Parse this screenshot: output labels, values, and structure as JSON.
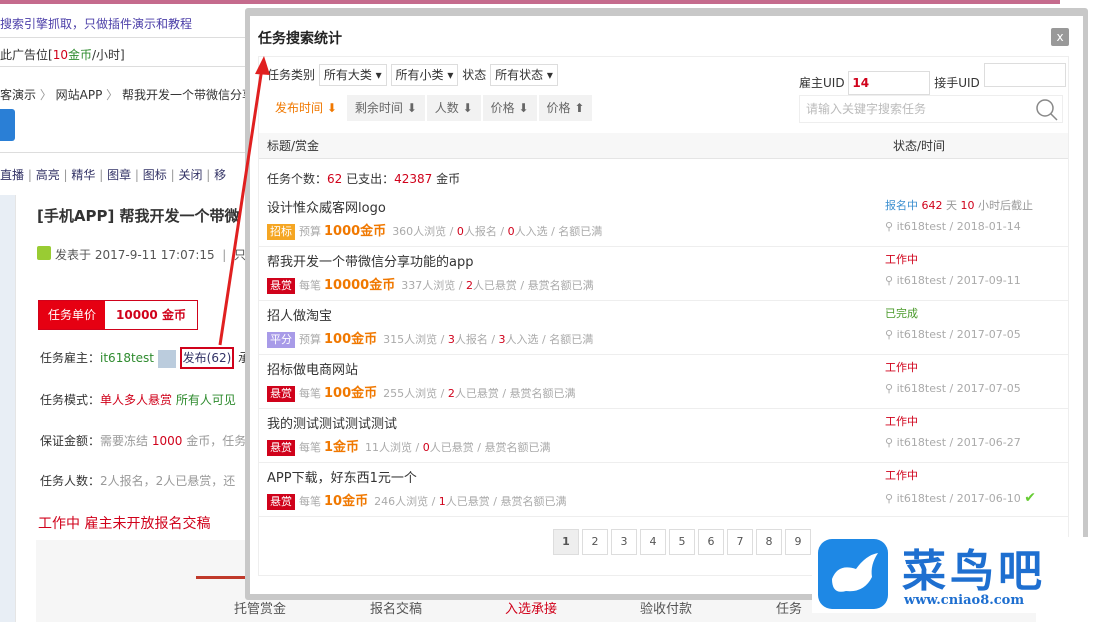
{
  "background": {
    "notice": "搜索引擎抓取，只做插件演示和教程",
    "ad": {
      "prefix": "此广告位[",
      "num": "10",
      "unit": "金币",
      "suffix": "/小时]"
    },
    "breadcrumb": [
      "客演示",
      "网站APP",
      "帮我开发一个带微信分享"
    ],
    "actions": [
      "直播",
      "高亮",
      "精华",
      "图章",
      "图标",
      "关闭",
      "移"
    ],
    "post_title": "[手机APP] 帮我开发一个带微",
    "post_meta": {
      "label": "发表于",
      "date": "2017-9-11 17:07:15",
      "extra": "只看"
    },
    "price": {
      "label": "任务单价",
      "value": "10000 金币"
    },
    "employer": {
      "label": "任务雇主：",
      "name": "it618test",
      "publish": "发布(62)",
      "tail": "承"
    },
    "mode": {
      "label": "任务模式：",
      "value": "单人多人悬赏",
      "extra": "所有人可见"
    },
    "deposit": {
      "label": "保证金额：",
      "prefix": "需要冻结",
      "value": "1000",
      "suffix": "金币，任务"
    },
    "people": {
      "label": "任务人数：",
      "value": "2人报名，2人已悬赏，还"
    },
    "status": "工作中 雇主未开放报名交稿",
    "steps": [
      "托管赏金",
      "报名交稿",
      "入选承接",
      "验收付款",
      "任务"
    ]
  },
  "modal": {
    "title": "任务搜索统计",
    "close": "x",
    "filters": {
      "category_label": "任务类别",
      "major": "所有大类",
      "minor": "所有小类",
      "status_label": "状态",
      "status": "所有状态",
      "employer_uid_label": "雇主UID",
      "employer_uid": "14",
      "worker_uid_label": "接手UID",
      "worker_uid": "",
      "search_placeholder": "请输入关键字搜索任务"
    },
    "sort_tabs": [
      "发布时间 ⬇",
      "剩余时间 ⬇",
      "人数 ⬇",
      "价格 ⬇",
      "价格 ⬆"
    ],
    "columns": [
      "标题/赏金",
      "状态/时间"
    ],
    "summary": {
      "count_label": "任务个数：",
      "count": "62",
      "spent_label": "已支出：",
      "spent": "42387",
      "unit": "金币"
    },
    "tasks": [
      {
        "title": "设计惟众威客网logo",
        "badge": "招标",
        "badge_color": "#f5a623",
        "price_label": "预算",
        "price": "1000金币",
        "views": "360人浏览",
        "a": "0",
        "a_label": "人报名",
        "b": "0",
        "b_label": "人入选",
        "quota": "名额已满",
        "status": "报名中",
        "status_color": "#3b8fd0",
        "days": "642",
        "days_label": "天",
        "hours": "10",
        "hours_label": "小时后截止",
        "user": "it618test",
        "date": "2018-01-14"
      },
      {
        "title": "帮我开发一个带微信分享功能的app",
        "badge": "悬赏",
        "badge_color": "#d0021b",
        "price_label": "每笔",
        "price": "10000金币",
        "views": "337人浏览",
        "a": "2",
        "a_label": "人已悬赏",
        "quota": "悬赏名额已满",
        "status": "工作中",
        "status_color": "#d0021b",
        "user": "it618test",
        "date": "2017-09-11"
      },
      {
        "title": "招人做淘宝",
        "badge": "平分",
        "badge_color": "#a89be8",
        "price_label": "预算",
        "price": "100金币",
        "views": "315人浏览",
        "a": "3",
        "a_label": "人报名",
        "b": "3",
        "b_label": "人入选",
        "quota": "名额已满",
        "status": "已完成",
        "status_color": "#4a9a2a",
        "user": "it618test",
        "date": "2017-07-05"
      },
      {
        "title": "招标做电商网站",
        "badge": "悬赏",
        "badge_color": "#d0021b",
        "price_label": "每笔",
        "price": "100金币",
        "views": "255人浏览",
        "a": "2",
        "a_label": "人已悬赏",
        "quota": "悬赏名额已满",
        "status": "工作中",
        "status_color": "#d0021b",
        "user": "it618test",
        "date": "2017-07-05"
      },
      {
        "title": "我的测试测试测试测试",
        "badge": "悬赏",
        "badge_color": "#d0021b",
        "price_label": "每笔",
        "price": "1金币",
        "views": "11人浏览",
        "a": "0",
        "a_label": "人已悬赏",
        "quota": "悬赏名额已满",
        "status": "工作中",
        "status_color": "#d0021b",
        "user": "it618test",
        "date": "2017-06-27"
      },
      {
        "title": "APP下载，好东西1元一个",
        "badge": "悬赏",
        "badge_color": "#d0021b",
        "price_label": "每笔",
        "price": "10金币",
        "views": "246人浏览",
        "a": "1",
        "a_label": "人已悬赏",
        "quota": "悬赏名额已满",
        "status": "工作中",
        "status_color": "#d0021b",
        "user": "it618test",
        "date": "2017-06-10",
        "check": true
      }
    ],
    "pages": [
      "1",
      "2",
      "3",
      "4",
      "5",
      "6",
      "7",
      "8",
      "9"
    ]
  },
  "watermark": {
    "title": "菜鸟吧",
    "url": "www.cniao8.com"
  }
}
